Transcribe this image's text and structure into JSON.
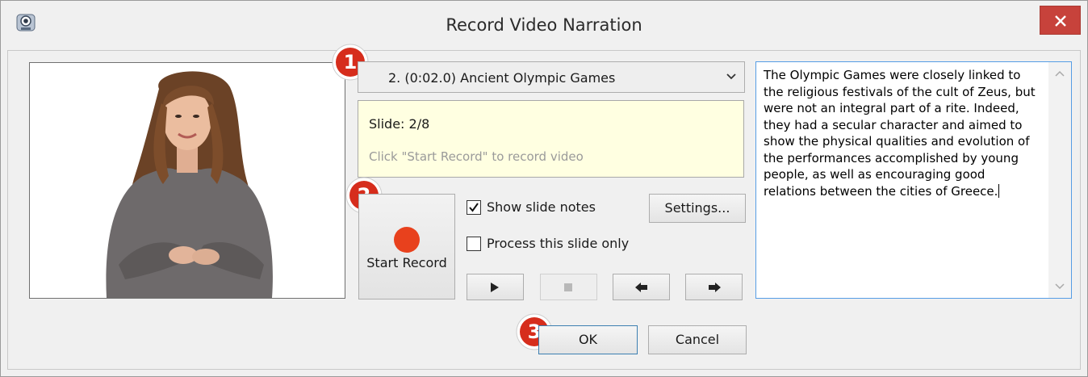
{
  "window": {
    "title": "Record Video Narration"
  },
  "slide_selector": {
    "value": "2. (0:02.0) Ancient Olympic Games"
  },
  "status": {
    "slide_label": "Slide: 2/8",
    "hint": "Click \"Start Record\" to record video"
  },
  "record": {
    "label": "Start Record",
    "accent": "#e8411d"
  },
  "options": {
    "show_notes": {
      "label": "Show slide notes",
      "checked": true
    },
    "process_only": {
      "label": "Process this slide only",
      "checked": false
    }
  },
  "settings_label": "Settings...",
  "transport": [
    {
      "name": "play-icon",
      "enabled": true
    },
    {
      "name": "stop-icon",
      "enabled": false
    },
    {
      "name": "arrow-left-icon",
      "enabled": true
    },
    {
      "name": "arrow-right-icon",
      "enabled": true
    }
  ],
  "notes": {
    "text": "The Olympic Games were closely linked to the religious festivals of the cult of Zeus, but were not an integral part of a rite. Indeed, they had a secular character and aimed to show the physical qualities and evolution of the performances accomplished by young people, as well as encouraging good relations between the cities of Greece."
  },
  "dialog_buttons": {
    "ok": "OK",
    "cancel": "Cancel"
  },
  "step_badges": [
    "1",
    "2",
    "3"
  ],
  "colors": {
    "close": "#c7423b",
    "badge": "#d62d1c",
    "focus": "#569de5"
  }
}
